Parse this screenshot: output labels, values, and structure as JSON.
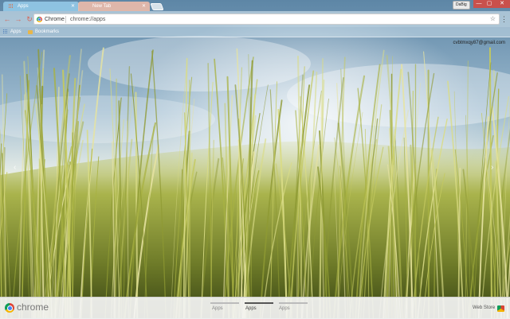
{
  "browser": {
    "tabs": [
      {
        "title": "Apps",
        "active": true
      },
      {
        "title": "New Tab",
        "active": false
      }
    ],
    "profile_label": "DaBig",
    "window_controls": {
      "minimize": "—",
      "maximize": "▢",
      "close": "✕"
    }
  },
  "toolbar": {
    "back_icon": "←",
    "forward_icon": "→",
    "reload_icon": "↻",
    "omnibox_chip": "Chrome",
    "url": "chrome://apps",
    "star_icon": "☆",
    "menu_icon": "⋮"
  },
  "bookmarks": {
    "items": [
      {
        "label": "Apps",
        "icon": "apps-grid-icon"
      },
      {
        "label": "Bookmarks",
        "icon": "folder-icon"
      }
    ]
  },
  "page": {
    "account_email": "cvbtmxqy87@gmail.com",
    "nav_left": "‹",
    "nav_right": "›"
  },
  "footer": {
    "wordmark": "chrome",
    "pages": [
      {
        "label": "Apps",
        "active": false
      },
      {
        "label": "Apps",
        "active": true
      },
      {
        "label": "Apps",
        "active": false
      }
    ],
    "webstore_label": "Web Store"
  },
  "colors": {
    "active_tab": "#96cdeb",
    "inactive_tab": "#f5beaa",
    "window_controls": "#c9504c",
    "nav_icons": "#d6685a"
  }
}
